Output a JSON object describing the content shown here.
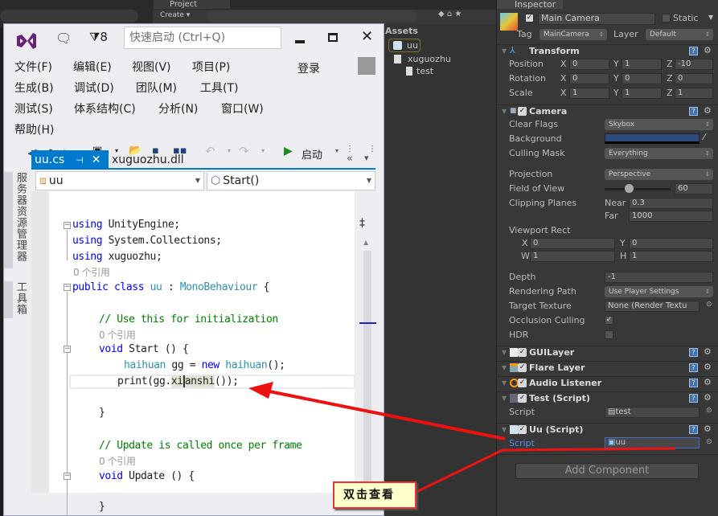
{
  "unity": {
    "project_tab": "Project",
    "create_label": "Create",
    "assets_title": "Assets",
    "assets": [
      {
        "name": "uu",
        "icon": "csharp-script-icon"
      },
      {
        "name": "xuguozhu",
        "icon": "dll-file-icon"
      },
      {
        "name": "test",
        "icon": "script-file-icon"
      }
    ]
  },
  "inspector": {
    "tab_label": "Inspector",
    "object_name": "Main Camera",
    "static_label": "Static",
    "tag_label": "Tag",
    "tag_value": "MainCamera",
    "layer_label": "Layer",
    "layer_value": "Default",
    "transform": {
      "title": "Transform",
      "rows": [
        {
          "label": "Position",
          "x": "0",
          "y": "1",
          "z": "-10"
        },
        {
          "label": "Rotation",
          "x": "0",
          "y": "0",
          "z": "0"
        },
        {
          "label": "Scale",
          "x": "1",
          "y": "1",
          "z": "1"
        }
      ]
    },
    "camera": {
      "title": "Camera",
      "clear_flags_label": "Clear Flags",
      "clear_flags_value": "Skybox",
      "background_label": "Background",
      "background_color": "#2e4a7a",
      "culling_mask_label": "Culling Mask",
      "culling_mask_value": "Everything",
      "projection_label": "Projection",
      "projection_value": "Perspective",
      "fov_label": "Field of View",
      "fov_value": "60",
      "fov_fraction": 0.33,
      "clipping_label": "Clipping Planes",
      "near_label": "Near",
      "near_value": "0.3",
      "far_label": "Far",
      "far_value": "1000",
      "viewport_label": "Viewport Rect",
      "vp_x": "0",
      "vp_y": "0",
      "vp_w": "1",
      "vp_h": "1",
      "depth_label": "Depth",
      "depth_value": "-1",
      "rendering_path_label": "Rendering Path",
      "rendering_path_value": "Use Player Settings",
      "target_texture_label": "Target Texture",
      "target_texture_value": "None (Render Textu",
      "occlusion_label": "Occlusion Culling",
      "occlusion_checked": true,
      "hdr_label": "HDR",
      "hdr_checked": false
    },
    "components": [
      {
        "title": "GUILayer"
      },
      {
        "title": "Flare Layer"
      },
      {
        "title": "Audio Listener"
      },
      {
        "title": "Test (Script)",
        "script_label": "Script",
        "script_value": "test"
      },
      {
        "title": "Uu (Script)",
        "script_label": "Script",
        "script_value": "uu"
      }
    ],
    "add_component": "Add Component"
  },
  "vs": {
    "notifications": "8",
    "quick_launch_placeholder": "快速启动 (Ctrl+Q)",
    "login": "登录",
    "menus": [
      "文件(F)",
      "编辑(E)",
      "视图(V)",
      "项目(P)",
      "生成(B)",
      "调试(D)",
      "团队(M)",
      "工具(T)",
      "测试(S)",
      "体系结构(C)",
      "分析(N)",
      "窗口(W)",
      "帮助(H)"
    ],
    "start_label": "启动",
    "side_tabs": [
      "服务器资源管理器",
      "工具箱"
    ],
    "tabs": [
      {
        "label": "uu.cs",
        "active": true
      },
      {
        "label": "xuguozhu.dll",
        "active": false
      }
    ],
    "nav_type": "uu",
    "nav_member": "Start()",
    "refs": "0 个引用",
    "code": {
      "l1_kw": "using",
      "l1_rest": " UnityEngine;",
      "l2_kw": "using",
      "l2_rest": " System.Collections;",
      "l3_kw": "using",
      "l3_rest": " xuguozhu;",
      "l5_kw": "public class",
      "l5_name": "uu",
      "l5_colon": " : ",
      "l5_base": "MonoBehaviour",
      "l5_brace": " {",
      "c1": "// Use this for initialization",
      "start_kw": "void",
      "start_rest": " Start () {",
      "l_hh_type": "haihuan",
      "l_hh_mid": " gg = ",
      "l_hh_new": "new",
      "l_hh_type2": "haihuan",
      "l_hh_end": "();",
      "print_pre": "print(gg.",
      "print_hl1": "xi",
      "print_hl2": "anshi",
      "print_end": "());",
      "close1": "}",
      "c2": "// Update is called once per frame",
      "update_kw": "void",
      "update_rest": " Update () {",
      "close2": "}"
    }
  },
  "callout": "双击查看"
}
